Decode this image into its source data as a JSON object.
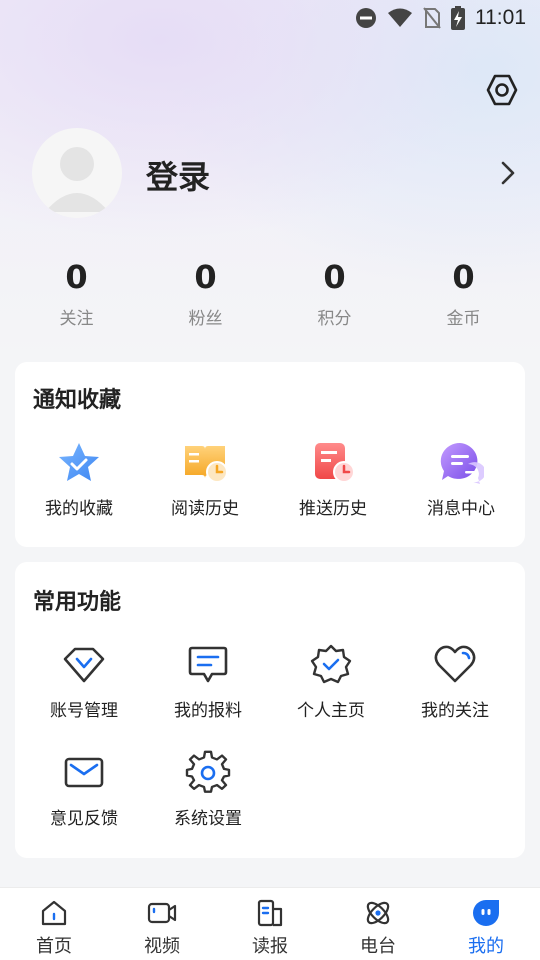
{
  "status_bar": {
    "time": "11:01",
    "icons": [
      "dnd-icon",
      "wifi-icon",
      "no-sim-icon",
      "battery-charging-icon"
    ]
  },
  "header": {
    "settings_icon": "settings-hexagon-icon"
  },
  "profile": {
    "login_label": "登录",
    "avatar_icon": "default-avatar-icon"
  },
  "stats": [
    {
      "value": "0",
      "label": "关注"
    },
    {
      "value": "0",
      "label": "粉丝"
    },
    {
      "value": "0",
      "label": "积分"
    },
    {
      "value": "0",
      "label": "金币"
    }
  ],
  "notify_card": {
    "title": "通知收藏",
    "items": [
      {
        "label": "我的收藏",
        "icon": "star-icon"
      },
      {
        "label": "阅读历史",
        "icon": "book-history-icon"
      },
      {
        "label": "推送历史",
        "icon": "push-history-icon"
      },
      {
        "label": "消息中心",
        "icon": "message-center-icon"
      }
    ]
  },
  "common_card": {
    "title": "常用功能",
    "items": [
      {
        "label": "账号管理",
        "icon": "account-diamond-icon"
      },
      {
        "label": "我的报料",
        "icon": "report-message-icon"
      },
      {
        "label": "个人主页",
        "icon": "verified-badge-icon"
      },
      {
        "label": "我的关注",
        "icon": "heart-icon"
      },
      {
        "label": "意见反馈",
        "icon": "mail-icon"
      },
      {
        "label": "系统设置",
        "icon": "gear-icon"
      }
    ]
  },
  "tabbar": {
    "tabs": [
      {
        "label": "首页",
        "icon": "home-icon"
      },
      {
        "label": "视频",
        "icon": "video-icon"
      },
      {
        "label": "读报",
        "icon": "newspaper-icon"
      },
      {
        "label": "电台",
        "icon": "radio-icon"
      },
      {
        "label": "我的",
        "icon": "mine-icon"
      }
    ],
    "active_index": 4
  },
  "colors": {
    "accent": "#1a6ef0",
    "muted_text": "#888888",
    "card_bg": "#ffffff",
    "page_bg": "#f4f5f7"
  }
}
